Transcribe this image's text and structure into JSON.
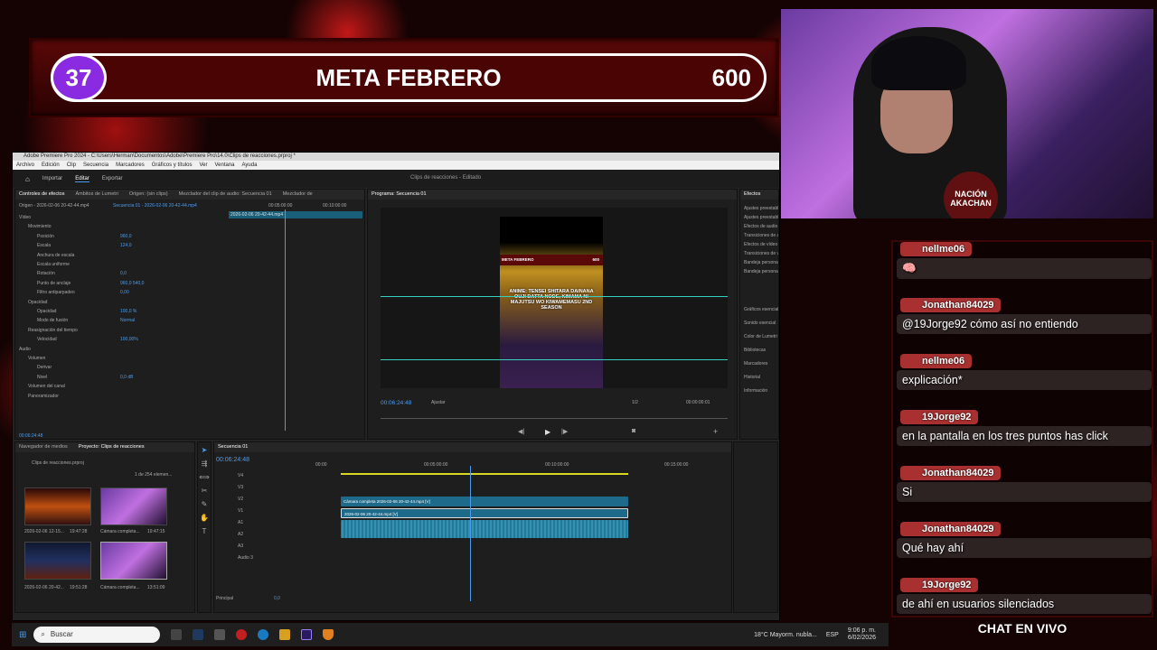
{
  "goal": {
    "count": "37",
    "title": "META FEBRERO",
    "target": "600"
  },
  "app": {
    "title": "Adobe Premiere Pro 2024 - C:\\Users\\Herman\\Documentos\\Adobe\\Premiere Pro\\14.0\\Clips de reacciones.prproj *",
    "menu": [
      "Archivo",
      "Edición",
      "Clip",
      "Secuencia",
      "Marcadores",
      "Gráficos y títulos",
      "Ver",
      "Ventana",
      "Ayuda"
    ],
    "workspace_tabs": [
      "Importar",
      "Editar",
      "Exportar"
    ],
    "project_name": "Clips de reacciones",
    "project_state": "Editado"
  },
  "effect_controls": {
    "tabs": [
      "Controles de efectos",
      "Ámbitos de Lumetri",
      "Origen: (sin clips)",
      "Mezclador del clip de audio: Secuencia 01",
      "Mezclador de"
    ],
    "source": "Origen - 2026-02-06 20-42-44.mp4",
    "sequence": "Secuencia 01 - 2026-02-06 20-42-44.mp4",
    "timecodes": [
      "00:05:00:00",
      "00:10:00:00"
    ],
    "clip_label": "2026-02-06 20-42-44.mp4",
    "rows": [
      {
        "label": "Vídeo",
        "value": ""
      },
      {
        "label": "Movimiento",
        "value": ""
      },
      {
        "label": "Posición",
        "value": "960,0"
      },
      {
        "label": "Escala",
        "value": "124,0"
      },
      {
        "label": "Anchura de escala",
        "value": ""
      },
      {
        "label": "Escala uniforme",
        "value": ""
      },
      {
        "label": "Rotación",
        "value": "0,0"
      },
      {
        "label": "Punto de anclaje",
        "value": "960,0    540,0"
      },
      {
        "label": "Filtro antiparpadeo",
        "value": "0,00"
      },
      {
        "label": "Opacidad",
        "value": ""
      },
      {
        "label": "Opacidad",
        "value": "100,0 %"
      },
      {
        "label": "Modo de fusión",
        "value": "Normal"
      },
      {
        "label": "Reasignación del tiempo",
        "value": ""
      },
      {
        "label": "Velocidad",
        "value": "100,00%"
      },
      {
        "label": "Audio",
        "value": ""
      },
      {
        "label": "Volumen",
        "value": ""
      },
      {
        "label": "Derivar",
        "value": ""
      },
      {
        "label": "Nivel",
        "value": "0,0 dB"
      },
      {
        "label": "Volumen del canal",
        "value": ""
      },
      {
        "label": "Panoramizador",
        "value": ""
      }
    ],
    "current_time": "00:06:24:48"
  },
  "program": {
    "tab": "Programa: Secuencia 01",
    "video_banner": "META FEBRERO",
    "video_banner_num": "600",
    "video_caption": "ANIME: TENSEI SHITARA DAINANA OUJI DATTA NODE, KIMAMA NI MAJUTSU WO KIWAMEMASU 2ND SEASON",
    "timecode": "00:06:24:48",
    "fit": "Ajustar",
    "zoom": "1/2",
    "duration": "00:00:00:01"
  },
  "effects": {
    "tab": "Efectos",
    "folders": [
      "Ajustes preestablecidos",
      "Ajustes preestablecidos de Lumetri",
      "Efectos de audio",
      "Transiciones de audio",
      "Efectos de vídeo",
      "Transiciones de vídeo",
      "Bandeja personalizada 01",
      "Bandeja personalizada 02"
    ],
    "panels": [
      "Gráficos esenciales",
      "Sonido esencial",
      "Color de Lumetri",
      "Bibliotecas",
      "Marcadores",
      "Historial",
      "Información"
    ]
  },
  "project": {
    "tabs": [
      "Navegador de medios",
      "Proyecto: Clips de reacciones"
    ],
    "file": "Clips de reacciones.prproj",
    "count": "1 de 254 elemen...",
    "items": [
      {
        "name": "2026-02-06 12-15...",
        "dur": "19:47:28"
      },
      {
        "name": "Cámara completa...",
        "dur": "19:47:15"
      },
      {
        "name": "2026-02-06 20-42...",
        "dur": "19:51:28"
      },
      {
        "name": "Cámara completa...",
        "dur": "13:51:09"
      }
    ]
  },
  "timeline": {
    "tab": "Secuencia 01",
    "timecode": "00:06:24:48",
    "ruler": [
      "00:00",
      "00:05:00:00",
      "00:10:00:00",
      "00:15:00:00"
    ],
    "tracks": [
      "V4",
      "V3",
      "V2",
      "V1",
      "A1",
      "A2",
      "A3",
      "Audio 3"
    ],
    "clips": [
      "Cámara completa 2026-02-06 20-42-44.mp4 [V]",
      "2026-02-06 20-42-44.mp4 [V]"
    ],
    "master": "Principal",
    "master_value": "0,0"
  },
  "chat": {
    "messages": [
      {
        "user": "nellme06",
        "text": "🧠"
      },
      {
        "user": "Jonathan84029",
        "text": "@19Jorge92 cómo así no entiendo"
      },
      {
        "user": "nellme06",
        "text": "explicación*"
      },
      {
        "user": "19Jorge92",
        "text": "en la pantalla en los tres puntos has click"
      },
      {
        "user": "Jonathan84029",
        "text": "Si"
      },
      {
        "user": "Jonathan84029",
        "text": "Qué hay ahí"
      },
      {
        "user": "19Jorge92",
        "text": "de ahí en usuarios silenciados"
      }
    ],
    "label": "CHAT EN VIVO"
  },
  "taskbar": {
    "search": "Buscar",
    "weather": "18°C  Mayorm. nubla...",
    "lang": "ESP",
    "time": "9:06 p. m.",
    "date": "6/02/2026"
  },
  "webcam_badge": "NACIÓN AKACHAN"
}
